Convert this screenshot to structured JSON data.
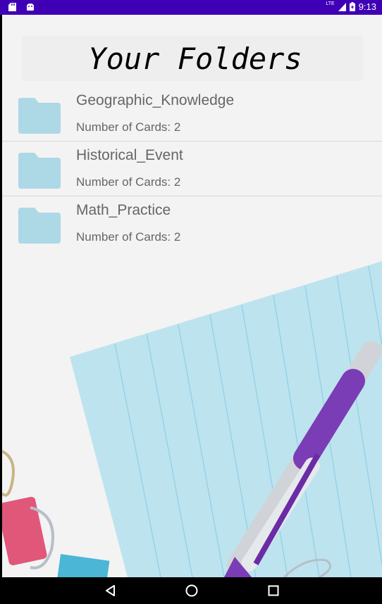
{
  "status_bar": {
    "left_icons": [
      "sd-card-icon",
      "android-icon"
    ],
    "network": "LTE",
    "time": "9:13"
  },
  "page": {
    "title": "Your Folders"
  },
  "folders": [
    {
      "name": "Geographic_Knowledge",
      "count_text": "Number of Cards: 2"
    },
    {
      "name": "Historical_Event",
      "count_text": "Number of Cards: 2"
    },
    {
      "name": "Math_Practice",
      "count_text": "Number of Cards: 2"
    }
  ],
  "nav_bar": {
    "buttons": [
      "back-icon",
      "home-icon",
      "recents-icon"
    ]
  },
  "colors": {
    "status_bar": "#3f00b5",
    "folder_icon": "#add8e6",
    "notepad": "#bde3ef"
  }
}
